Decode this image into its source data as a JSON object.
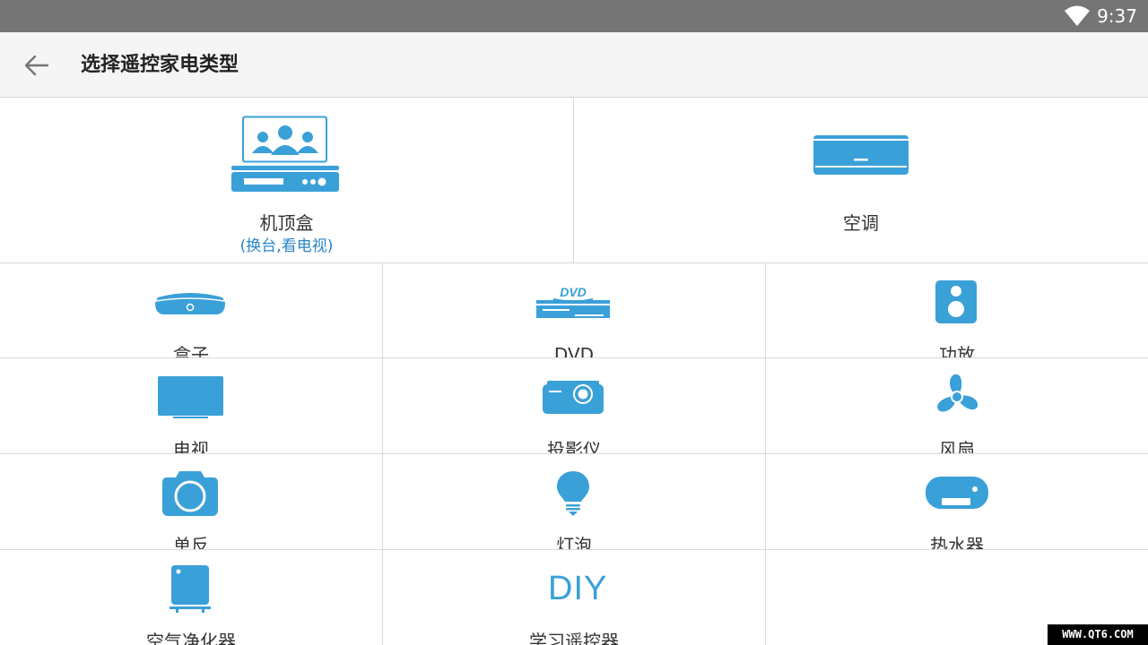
{
  "status_bar": {
    "time": "9:37"
  },
  "app_bar": {
    "title": "选择遥控家电类型"
  },
  "devices": {
    "set_top_box": {
      "label": "机顶盒",
      "sublabel": "(换台,看电视)"
    },
    "air_conditioner": {
      "label": "空调"
    },
    "box": {
      "label": "盒子"
    },
    "dvd": {
      "label": "DVD",
      "icon_text": "DVD"
    },
    "amplifier": {
      "label": "功放"
    },
    "tv": {
      "label": "电视"
    },
    "projector": {
      "label": "投影仪"
    },
    "fan": {
      "label": "风扇"
    },
    "slr_camera": {
      "label": "单反"
    },
    "light_bulb": {
      "label": "灯泡"
    },
    "water_heater": {
      "label": "热水器"
    },
    "air_purifier": {
      "label": "空气净化器"
    },
    "learning_remote": {
      "label": "学习遥控器",
      "icon_text": "DIY"
    }
  },
  "watermark": "WWW.QT6.COM",
  "colors": {
    "accent": "#3aa0d8",
    "status_bar": "#757575",
    "app_bar": "#f5f5f5",
    "sublabel": "#2a86c7"
  }
}
